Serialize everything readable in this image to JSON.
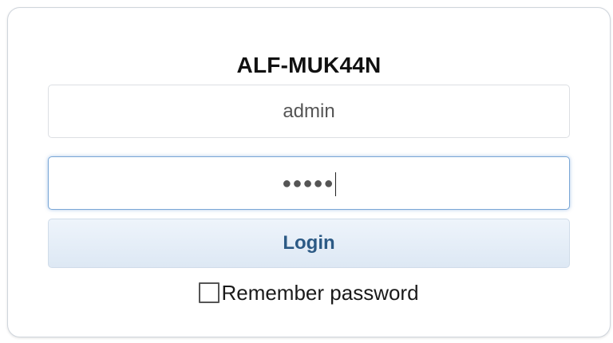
{
  "login": {
    "title": "ALF-MUK44N",
    "username_value": "admin",
    "password_masked": "●●●●●",
    "login_label": "Login",
    "remember_label": "Remember password",
    "remember_checked": false
  }
}
